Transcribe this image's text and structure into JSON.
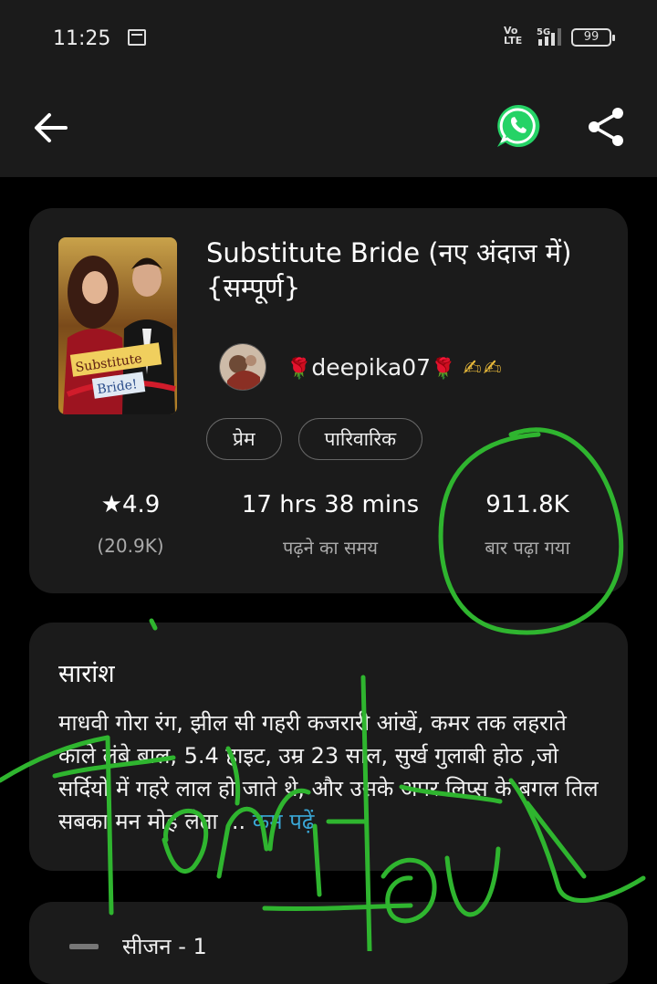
{
  "status_bar": {
    "time": "11:25",
    "network_vo": "Vo",
    "network_lte": "LTE",
    "network_5g": "5G",
    "battery": "99"
  },
  "app_bar": {
    "back_icon": "arrow-left-icon",
    "whatsapp_icon": "whatsapp-icon",
    "share_icon": "share-icon"
  },
  "book": {
    "title": "Substitute Bride (नए अंदाज में) {सम्पूर्ण}",
    "cover_text_line1": "Substitute",
    "cover_text_line2": "Bride!",
    "author": "deepika07",
    "author_emoji_left": "🌹",
    "author_emoji_right": "🌹",
    "author_suffix": "✍✍",
    "tags": [
      "प्रेम",
      "पारिवारिक"
    ],
    "rating": {
      "value": "★4.9",
      "label": "(20.9K)"
    },
    "read_time": {
      "value": "17 hrs 38 mins",
      "label": "पढ़ने का समय"
    },
    "reads": {
      "value": "911.8K",
      "label": "बार पढ़ा गया"
    }
  },
  "summary": {
    "heading": "सारांश",
    "text": "माधवी गोरा रंग, झील सी गहरी कजरारी आंखें,  कमर तक लहराते काले लंबे बाल, 5.4 हाइट, उम्र 23 साल, सुर्ख गुलाबी होठ ,जो सर्दियों में गहरे लाल हो जाते थे, और उसके अपर लिप्स के बगल तिल सबका मन मोह लेता ...",
    "less_link": "कम पढ़ें"
  },
  "season": {
    "label": "सीजन - 1"
  },
  "colors": {
    "background": "#000000",
    "card": "#1b1b1b",
    "link": "#3aa7d6",
    "annotation_green": "#2fb52f"
  }
}
